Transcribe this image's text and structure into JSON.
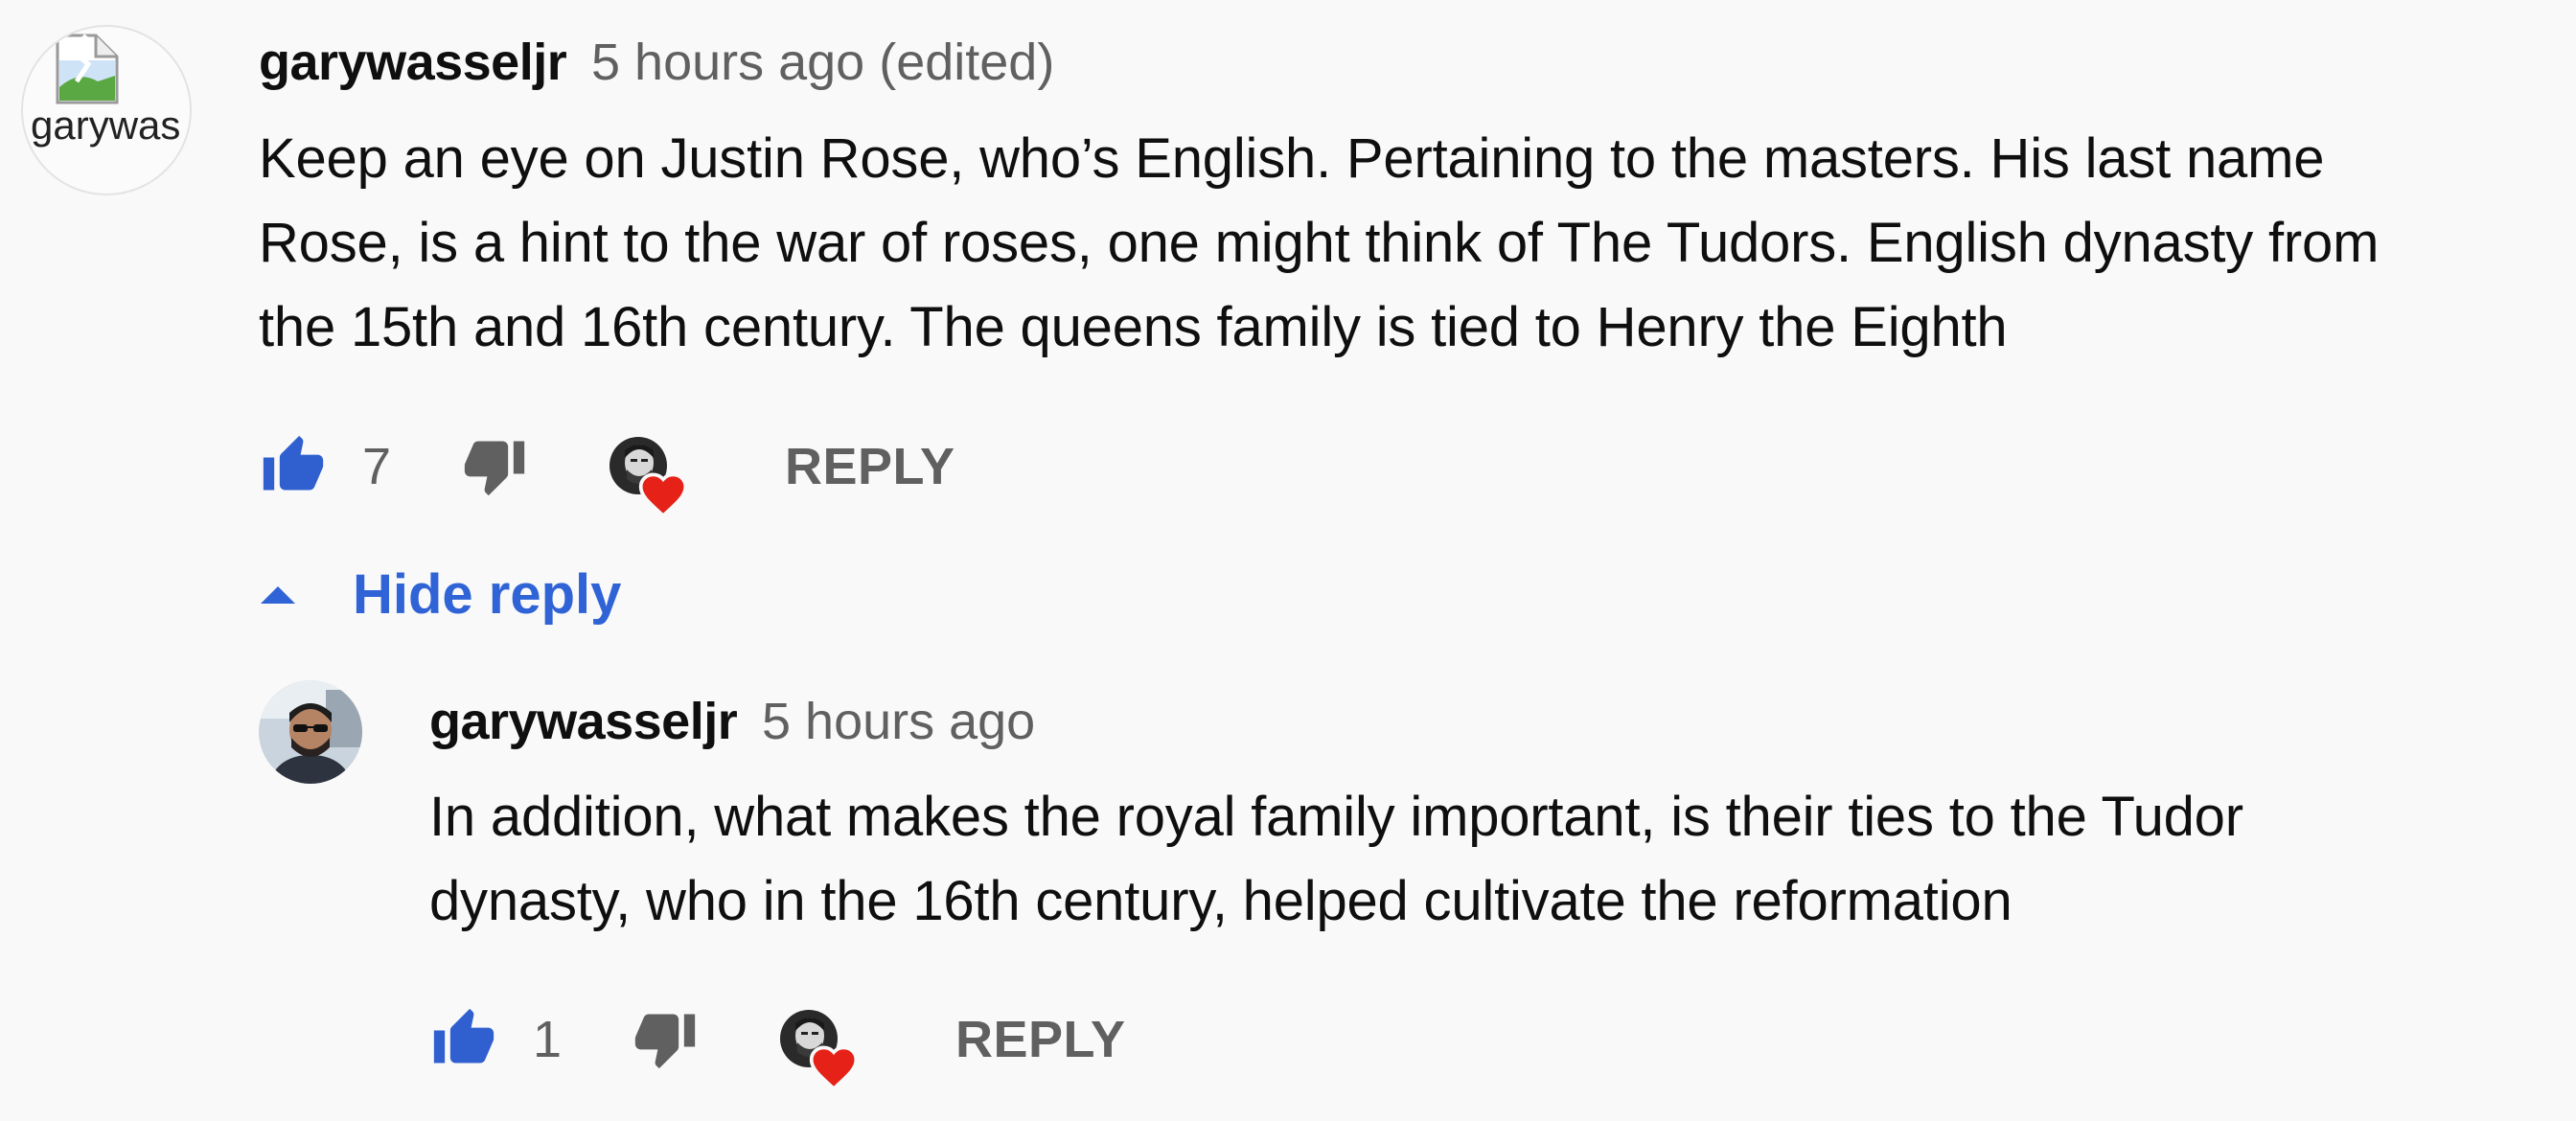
{
  "comment": {
    "avatar_alt": "garywas",
    "username": "garywasseljr",
    "timestamp": "5 hours ago (edited)",
    "lines": [
      "Keep an eye on Justin Rose, who’s English. Pertaining to the masters. His last name",
      "Rose, is a hint to the war of roses, one might think of The Tudors. English dynasty from",
      "the 15th and 16th century. The queens family is tied to Henry the Eighth"
    ],
    "like_count": "7",
    "reply_label": "REPLY"
  },
  "replies_toggle": {
    "label": "Hide reply"
  },
  "reply": {
    "username": "garywasseljr",
    "timestamp": "5 hours ago",
    "lines": [
      "In addition, what makes the royal family important, is their ties to the Tudor",
      "dynasty, who in the 16th century, helped cultivate the reformation"
    ],
    "like_count": "1",
    "reply_label": "REPLY"
  },
  "colors": {
    "background": "#f9f9f9",
    "like_blue": "#3060d0",
    "link_blue": "#2f63d6",
    "heart_red": "#e62117",
    "muted_gray": "#606060"
  },
  "icons": {
    "like": "thumb-up-icon",
    "dislike": "thumb-down-icon",
    "heart": "creator-heart-icon",
    "caret": "caret-up-icon"
  }
}
